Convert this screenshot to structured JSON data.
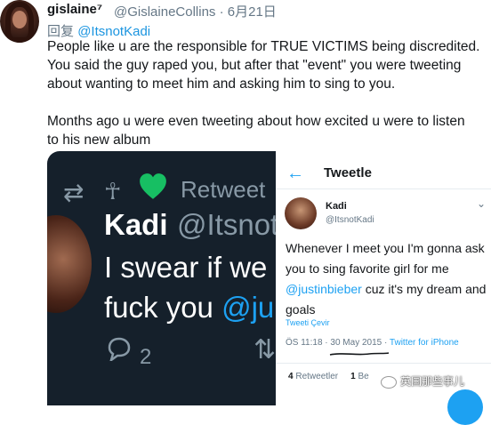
{
  "tweet": {
    "author_name": "gislaine⁷",
    "author_handle": "@GislaineCollins · 6月21日",
    "reply_prefix": "回复",
    "reply_to": "@ItsnotKadi",
    "body_lines": [
      "People like u are the responsible for TRUE VICTIMS being discredited.",
      "You said the guy raped you, but after that \"event\" you were tweeting",
      "about wanting to meet him and asking him to sing to you.",
      "Months ago u were even tweeting about how excited u were to listen",
      "to his new album"
    ]
  },
  "dark_screenshot": {
    "retweet_label": "Retweet",
    "name": "Kadi",
    "handle": "@Itsnot",
    "line1": "I swear if we",
    "line2_start": "fuck you ",
    "line2_mention": "@ju",
    "reply_count": "2",
    "colors": {
      "background": "#15202b",
      "heart": "#17bf63"
    }
  },
  "light_screenshot": {
    "title": "Tweetle",
    "name": "Kadi",
    "handle": "@ItsnotKadi",
    "text_before": "Whenever I meet you I'm gonna ask you to sing favorite girl for me ",
    "text_mention": "@justinbieber",
    "text_after": " cuz it's my dream and goals",
    "translate": "Tweeti Çevir",
    "meta_time": "ÖS 11:18 · 30 May 2015 · ",
    "meta_client": "Twitter for iPhone",
    "retweet_count": "4",
    "retweet_label": "Retweetler",
    "like_count": "1",
    "like_label": "Be"
  },
  "watermark": "英国那些事儿",
  "icons": [
    "back-arrow-icon",
    "retweet-icon",
    "heart-icon",
    "reply-icon",
    "more-icon"
  ],
  "accent_color": "#1da1f2"
}
